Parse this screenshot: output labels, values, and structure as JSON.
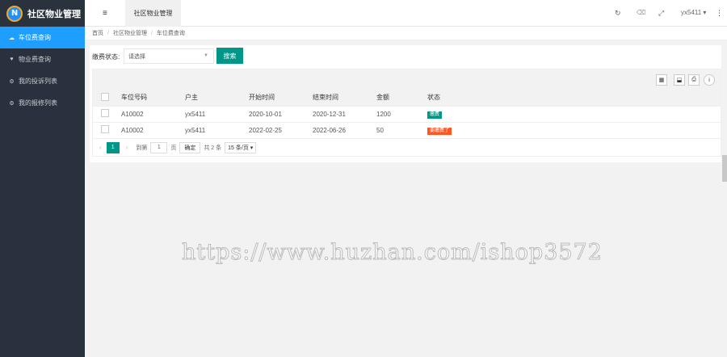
{
  "app": {
    "name": "社区物业管理",
    "logo_letter": "N"
  },
  "sidebar": {
    "items": [
      {
        "label": "车位费查询",
        "icon": "cloud-icon",
        "glyph": "☁",
        "active": true
      },
      {
        "label": "物业费查询",
        "icon": "heart-icon",
        "glyph": "♥",
        "active": false
      },
      {
        "label": "我的投诉列表",
        "icon": "gear-icon",
        "glyph": "⚙",
        "active": false
      },
      {
        "label": "我的报修列表",
        "icon": "gear-icon",
        "glyph": "⚙",
        "active": false
      }
    ]
  },
  "header": {
    "tab_label": "社区物业管理",
    "user": "yx5411 ▾",
    "hamburger_glyph": "≡",
    "refresh_glyph": "↻",
    "trash_glyph": "🗑",
    "fullscreen_glyph": "⤢",
    "more_glyph": "⋮"
  },
  "breadcrumb": [
    "首页",
    "社区物业管理",
    "车位费查询"
  ],
  "filter": {
    "label": "缴费状态:",
    "placeholder": "请选择",
    "search_button": "搜索"
  },
  "table": {
    "columns": [
      "车位号码",
      "户主",
      "开始时间",
      "结束时间",
      "金额",
      "状态"
    ],
    "rows": [
      {
        "space": "A10002",
        "owner": "yx5411",
        "start": "2020-10-01",
        "end": "2020-12-31",
        "amount": "1200",
        "status": "缴费",
        "status_color": "#009688"
      },
      {
        "space": "A10002",
        "owner": "yx5411",
        "start": "2022-02-25",
        "end": "2022-06-26",
        "amount": "50",
        "status": "要缴费了",
        "status_color": "#ff5722"
      }
    ]
  },
  "pager": {
    "prev": "‹",
    "current": "1",
    "next": "›",
    "goto_label": "到第",
    "goto_value": "1",
    "page_unit": "页",
    "confirm": "确定",
    "total": "共 2 条",
    "page_size": "15 条/页 ▾"
  },
  "watermark": "https://www.huzhan.com/ishop3572"
}
